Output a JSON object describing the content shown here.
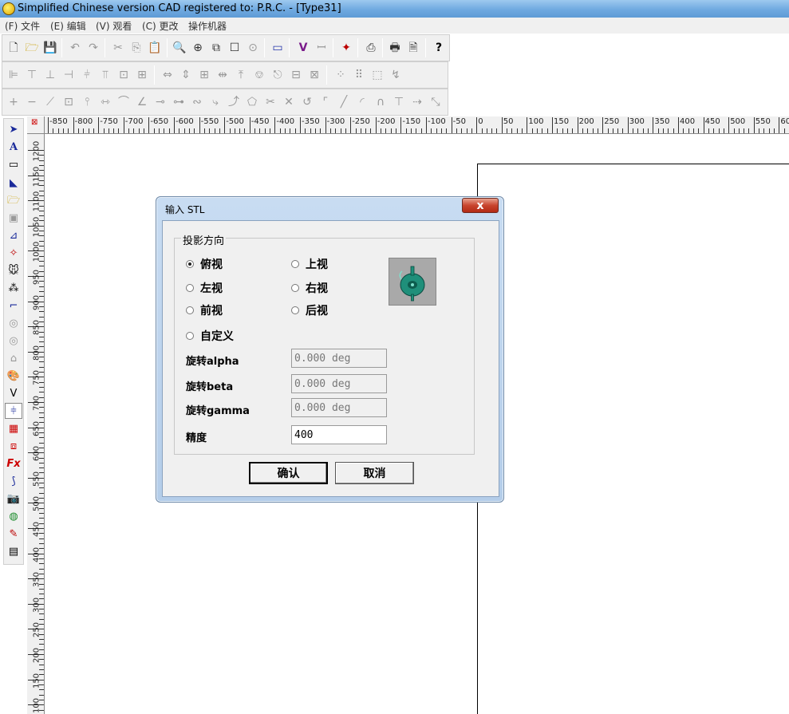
{
  "window": {
    "title": "Simplified Chinese  version  CAD registered to: P.R.C.  - [Type31]"
  },
  "menu": [
    "(F) 文件",
    "(E) 编辑",
    "(V) 观看",
    "(C) 更改",
    "操作机器"
  ],
  "ruler_h_labels": [
    "-850",
    "-800",
    "-750",
    "-700",
    "-650",
    "-600",
    "-550",
    "-500",
    "-450",
    "-400",
    "-350",
    "-300",
    "-250",
    "-200",
    "-150",
    "-100",
    "-50",
    "0",
    "50",
    "100",
    "150",
    "200",
    "250",
    "300",
    "350",
    "400",
    "450",
    "500",
    "550",
    "60"
  ],
  "ruler_v_labels": [
    "1200",
    "1150",
    "1100",
    "1050",
    "1000",
    "950",
    "900",
    "850",
    "800",
    "750",
    "700",
    "650",
    "600",
    "550",
    "500",
    "450",
    "400",
    "350",
    "300",
    "250",
    "200",
    "150",
    "100"
  ],
  "dialog": {
    "title": "输入 STL",
    "close_label": "x",
    "group_title": "投影方向",
    "radios": [
      {
        "label": "俯视",
        "checked": true
      },
      {
        "label": "上视",
        "checked": false
      },
      {
        "label": "左视",
        "checked": false
      },
      {
        "label": "右视",
        "checked": false
      },
      {
        "label": "前视",
        "checked": false
      },
      {
        "label": "后视",
        "checked": false
      },
      {
        "label": "自定义",
        "checked": false
      }
    ],
    "fields": [
      {
        "label": "旋转alpha",
        "value": "0.000 deg",
        "enabled": false
      },
      {
        "label": "旋转beta",
        "value": "0.000 deg",
        "enabled": false
      },
      {
        "label": "旋转gamma",
        "value": "0.000 deg",
        "enabled": false
      },
      {
        "label": "精度",
        "value": "400",
        "enabled": true
      }
    ],
    "ok_label": "确认",
    "cancel_label": "取消"
  },
  "colors": {
    "titlebar": "#6fa9e0",
    "preview_object": "#1f8f7a",
    "close_button": "#c8452e"
  }
}
